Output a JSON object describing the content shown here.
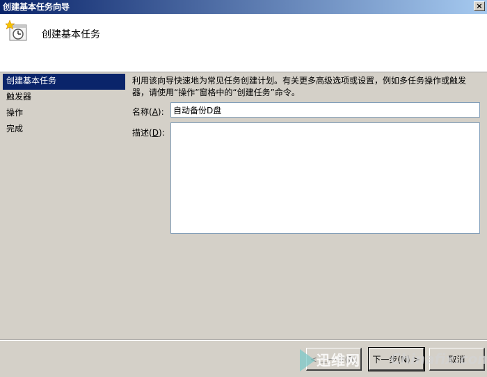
{
  "window": {
    "title": "创建基本任务向导",
    "close_glyph": "×"
  },
  "header": {
    "title": "创建基本任务"
  },
  "nav": {
    "items": [
      {
        "label": "创建基本任务"
      },
      {
        "label": "触发器"
      },
      {
        "label": "操作"
      },
      {
        "label": "完成"
      }
    ]
  },
  "main": {
    "intro": "利用该向导快速地为常见任务创建计划。有关更多高级选项或设置，例如多任务操作或触发器，请使用“操作”窗格中的“创建任务”命令。",
    "name_label": "名称",
    "name_key": "A",
    "name_value": "自动备份D盘",
    "desc_label": "描述",
    "desc_key": "D",
    "desc_value": ""
  },
  "buttons": {
    "back": "< 上一步(B)",
    "next": "下一步(N) >",
    "cancel": "取消"
  },
  "watermark": {
    "cn": "迅维网",
    "en": "Chinafix.com"
  },
  "colors": {
    "titlebar_start": "#0a246a",
    "selected_nav": "#0a246a",
    "dialog_bg": "#d4d0c8"
  }
}
